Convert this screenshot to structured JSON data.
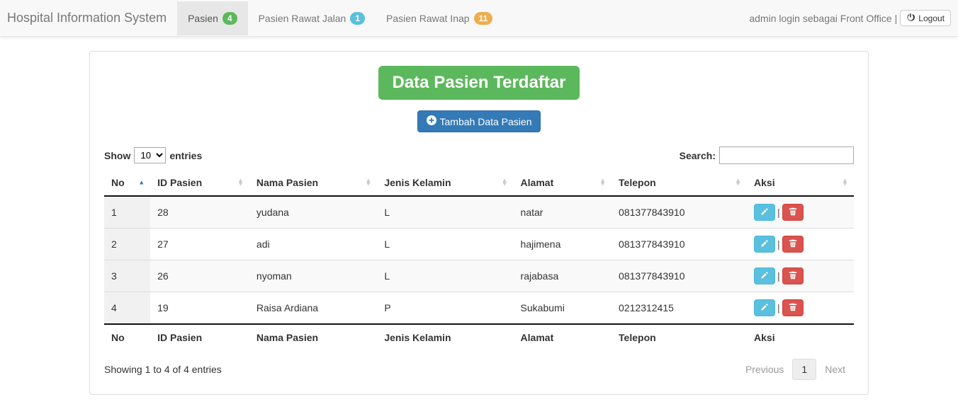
{
  "navbar": {
    "brand": "Hospital Information System",
    "tabs": [
      {
        "label": "Pasien",
        "badge": "4",
        "badge_color": "green",
        "active": true
      },
      {
        "label": "Pasien Rawat Jalan",
        "badge": "1",
        "badge_color": "blue",
        "active": false
      },
      {
        "label": "Pasien Rawat Inap",
        "badge": "11",
        "badge_color": "orange",
        "active": false
      }
    ],
    "login_text": "admin login sebagai Front Office",
    "sep": " | ",
    "logout": "Logout"
  },
  "page": {
    "title": "Data Pasien Terdaftar",
    "add_btn": "Tambah Data Pasien"
  },
  "dt": {
    "show": "Show",
    "entries": "entries",
    "length_value": "10",
    "search_label": "Search:",
    "search_value": "",
    "info": "Showing 1 to 4 of 4 entries",
    "prev": "Previous",
    "next": "Next",
    "page_current": "1"
  },
  "columns": [
    "No",
    "ID Pasien",
    "Nama Pasien",
    "Jenis Kelamin",
    "Alamat",
    "Telepon",
    "Aksi"
  ],
  "rows": [
    {
      "no": "1",
      "id": "28",
      "nama": "yudana",
      "jk": "L",
      "alamat": "natar",
      "tel": "081377843910"
    },
    {
      "no": "2",
      "id": "27",
      "nama": "adi",
      "jk": "L",
      "alamat": "hajimena",
      "tel": "081377843910"
    },
    {
      "no": "3",
      "id": "26",
      "nama": "nyoman",
      "jk": "L",
      "alamat": "rajabasa",
      "tel": "081377843910"
    },
    {
      "no": "4",
      "id": "19",
      "nama": "Raisa Ardiana",
      "jk": "P",
      "alamat": "Sukabumi",
      "tel": "0212312415"
    }
  ],
  "action_sep": "|"
}
